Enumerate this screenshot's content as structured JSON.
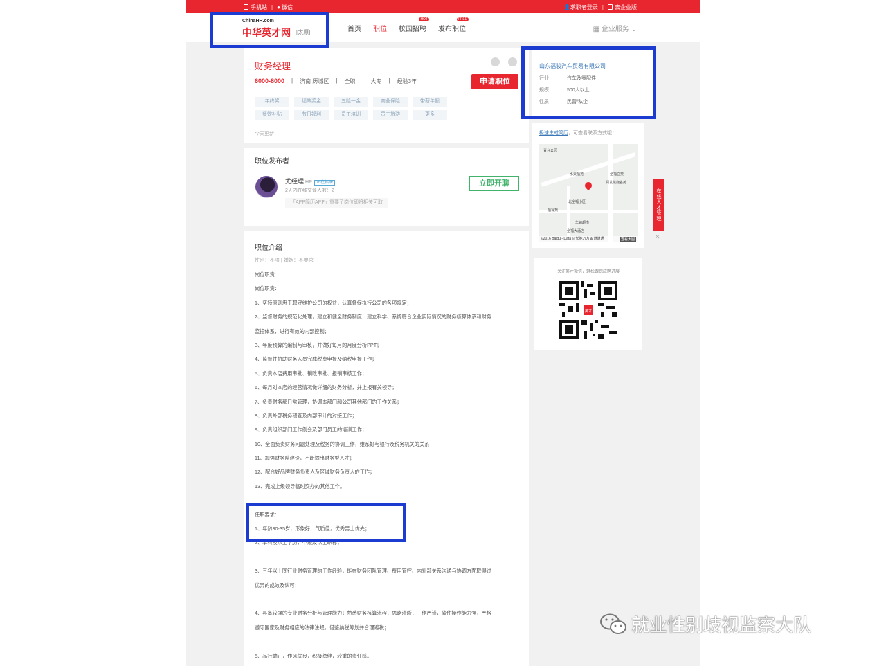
{
  "topbar": {
    "mobile": "手机站",
    "wechat": "微信",
    "login": "求职者登录",
    "enterprise": "去企业版"
  },
  "header": {
    "logo_small": "ChinaHR.com",
    "logo_big": "中华英才网",
    "city": "[太原]",
    "nav": [
      {
        "label": "首页",
        "badge": ""
      },
      {
        "label": "职位",
        "badge": ""
      },
      {
        "label": "校园招聘",
        "badge": "HOT"
      },
      {
        "label": "发布职位",
        "badge": "FREE"
      }
    ],
    "enterprise_service": "企业服务"
  },
  "job": {
    "title": "财务经理",
    "salary": "6000-8000",
    "location": "济南 历城区",
    "type": "全职",
    "education": "大专",
    "experience": "经验3年",
    "apply_label": "申请职位",
    "benefits": [
      "年终奖",
      "绩效奖金",
      "五险一金",
      "商业保险",
      "带薪年假",
      "餐饮补贴",
      "节日福利",
      "员工培训",
      "员工旅游",
      "更多"
    ],
    "updated": "今天更新"
  },
  "publisher": {
    "section_title": "职位发布者",
    "name": "尤经理",
    "role": "HR",
    "online": "正在招聘",
    "stat": "2天内在线交谈人数：2",
    "note": "「APP简历APP」重要了岗位即将相关可取",
    "chat_label": "立即开聊"
  },
  "description": {
    "section_title": "职位介绍",
    "meta": "性别：不限  |  婚姻：不要求",
    "lines": [
      "岗位职责:",
      "岗位职责：",
      "1、坚持原则忠于职守维护公司的权益，认真督促执行公司的各项规定；",
      "2、监督财务的规范化处理，建立和健全财务制度，建立科学、系统符合企业实际情况的财务核算体系和财务",
      "监控体系，进行有效的内部控制；",
      "3、年度预算的编制与审核，并做好每月的月度分析PPT；",
      "4、监督并协助财务人员完成税费申报及纳税申报工作；",
      "5、负责本店费用审批、销政审批、报销审核工作；",
      "6、每月对本店的经营情况做详细的财务分析，并上报有关领导；",
      "7、负责财务部日常管理，协调本部门和公司其他部门的工作关系；",
      "8、负责外部税务稽查及内部审计的对接工作；",
      "9、负责组织部门工作例会及部门员工的培训工作；",
      "10、全面负责财务问题处理及税务的协调工作，维系好与银行及税务机关的关系",
      "11、加强财务队建设，不断输出财务型人才；",
      "12、配合好品牌财务负责人及区域财务负责人的工作；",
      "13、完成上级领导临时交办的其他工作。",
      "",
      "任职要求：",
      "1、年龄30-35岁，形象好，气质佳，优秀男士优先；",
      "2、本科及以上学历，中级及以上职称；",
      "",
      "3、三年以上同行业财务管理的工作经验，能在财务团队管理、费用管控、内外部关系沟通与协调方面取得过",
      "优异的成效及认可；",
      "",
      "4、具备较强的专业财务分析与管理能力；熟悉财务核算流程，思路清晰，工作严谨，软件操作能力强，严格",
      "遵守国家及财务相应的法律法规，借鉴纳税筹划并合理避税；",
      "",
      "5、品行端正，作风优良，积极稳健，较重的责任感。"
    ]
  },
  "company": {
    "name": "山东福骏汽车贸易有限公司",
    "industry_label": "行业",
    "industry": "汽车及零配件",
    "size_label": "规模",
    "size": "500人以上",
    "nature_label": "性质",
    "nature": "民营/私企"
  },
  "map": {
    "quick_link": "极速生成简历",
    "quick_text": "，可查看联系方式哦！",
    "labels": [
      "青台公园",
      "水天福苑",
      "全福立交",
      "润发凯旋名苑",
      "北全福小区",
      "福禄苑",
      "华铭超市",
      "全福大酒店"
    ],
    "footer": "©2016 Baidu - Data © 长地万方 & 道道通",
    "view_big": "查看大图"
  },
  "qr": {
    "caption": "关注英才微信，轻松跟踪应聘进展",
    "center_text": "英才"
  },
  "side_tab": "在线人才管理",
  "watermark": "就业性别歧视监察大队"
}
